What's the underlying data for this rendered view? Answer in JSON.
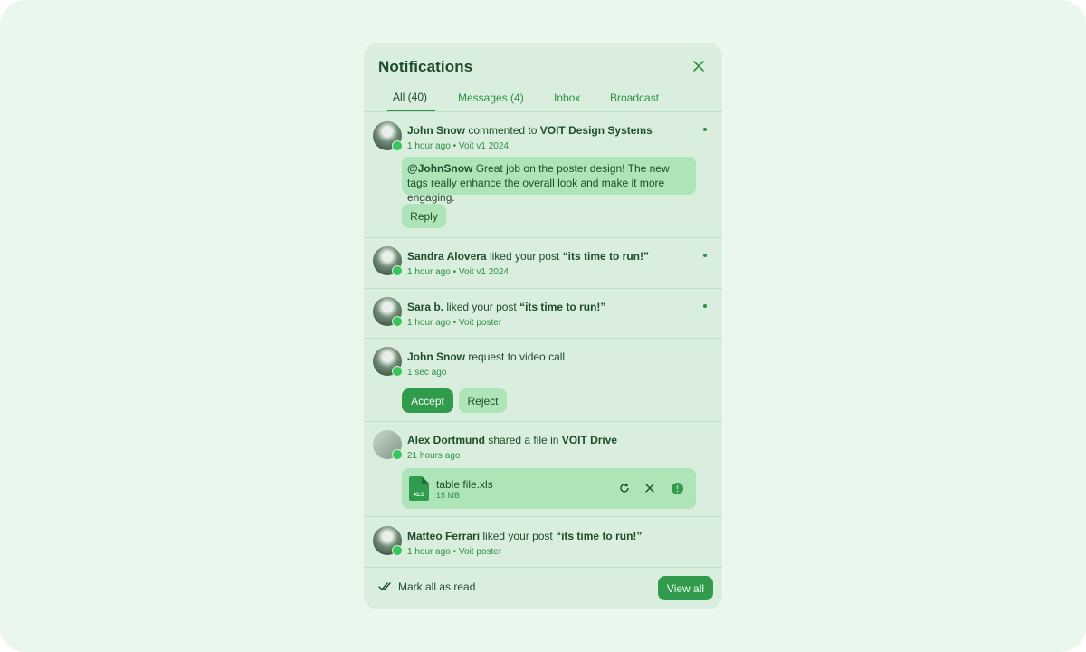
{
  "panel": {
    "title": "Notifications"
  },
  "tabs": [
    {
      "label": "All (40)"
    },
    {
      "label": "Messages (4)"
    },
    {
      "label": "Inbox"
    },
    {
      "label": "Broadcast"
    }
  ],
  "notifications": [
    {
      "actor": "John Snow",
      "action": "commented to",
      "target": "VOIT Design Systems",
      "time": "1 hour ago",
      "context": "Voit v1 2024",
      "mention": "@JohnSnow",
      "message": "Great job on the poster design! The new tags really enhance the overall look and make it more engaging.",
      "button": "Reply"
    },
    {
      "actor": "Sandra Alovera",
      "action": "liked your post",
      "target": "“its time to run!”",
      "time": "1 hour ago",
      "context": "Voit v1 2024"
    },
    {
      "actor": "Sara b.",
      "action": "liked your post",
      "target": "“its time to run!”",
      "time": "1 hour ago",
      "context": "Voit poster"
    },
    {
      "actor": "John Snow",
      "action": "request to video call",
      "time": "1 sec ago",
      "accept": "Accept",
      "reject": "Reject"
    },
    {
      "actor": "Alex Dortmund",
      "action": "shared a file in",
      "target": "VOIT Drive",
      "time": "21 hours ago",
      "file": {
        "name": "table file.xls",
        "size": "15 MB",
        "ext": "XLS"
      }
    },
    {
      "actor": "Matteo Ferrari",
      "action": "liked your post",
      "target": "“its time to run!”",
      "time": "1 hour ago",
      "context": "Voit poster"
    }
  ],
  "separator": "•",
  "footer": {
    "mark_all": "Mark all as read",
    "view_all": "View all"
  },
  "colors": {
    "background": "#eaf7ec",
    "panel": "#d9eedc",
    "accent": "#2f9b4b",
    "text": "#1e4d2b",
    "muted": "#2f8f47",
    "bubble": "#aee5b8",
    "online": "#34c759"
  }
}
